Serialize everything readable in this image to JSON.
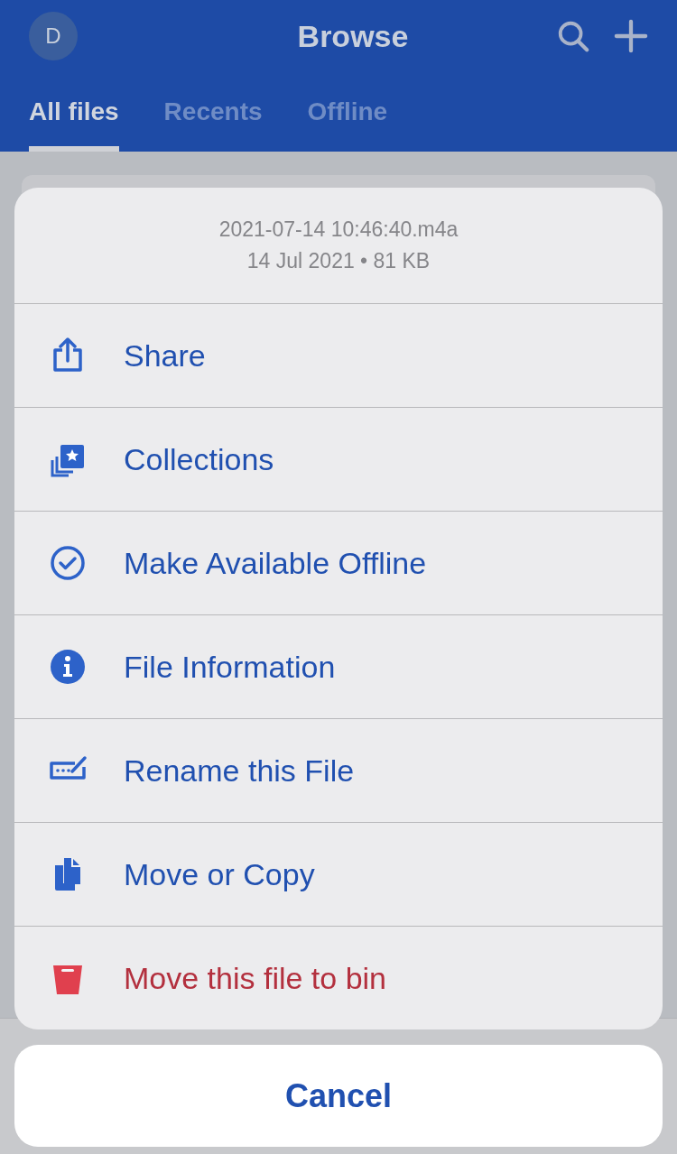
{
  "header": {
    "avatar": "D",
    "title": "Browse"
  },
  "tabs": [
    {
      "label": "All files",
      "selected": true
    },
    {
      "label": "Recents",
      "selected": false
    },
    {
      "label": "Offline",
      "selected": false
    }
  ],
  "sheet": {
    "file_name": "2021-07-14 10:46:40.m4a",
    "file_meta": "14 Jul 2021 • 81 KB",
    "actions": [
      {
        "label": "Share",
        "destructive": false
      },
      {
        "label": "Collections",
        "destructive": false
      },
      {
        "label": "Make Available Offline",
        "destructive": false
      },
      {
        "label": "File Information",
        "destructive": false
      },
      {
        "label": "Rename this File",
        "destructive": false
      },
      {
        "label": "Move or Copy",
        "destructive": false
      },
      {
        "label": "Move this file to bin",
        "destructive": true
      }
    ],
    "cancel": "Cancel"
  }
}
